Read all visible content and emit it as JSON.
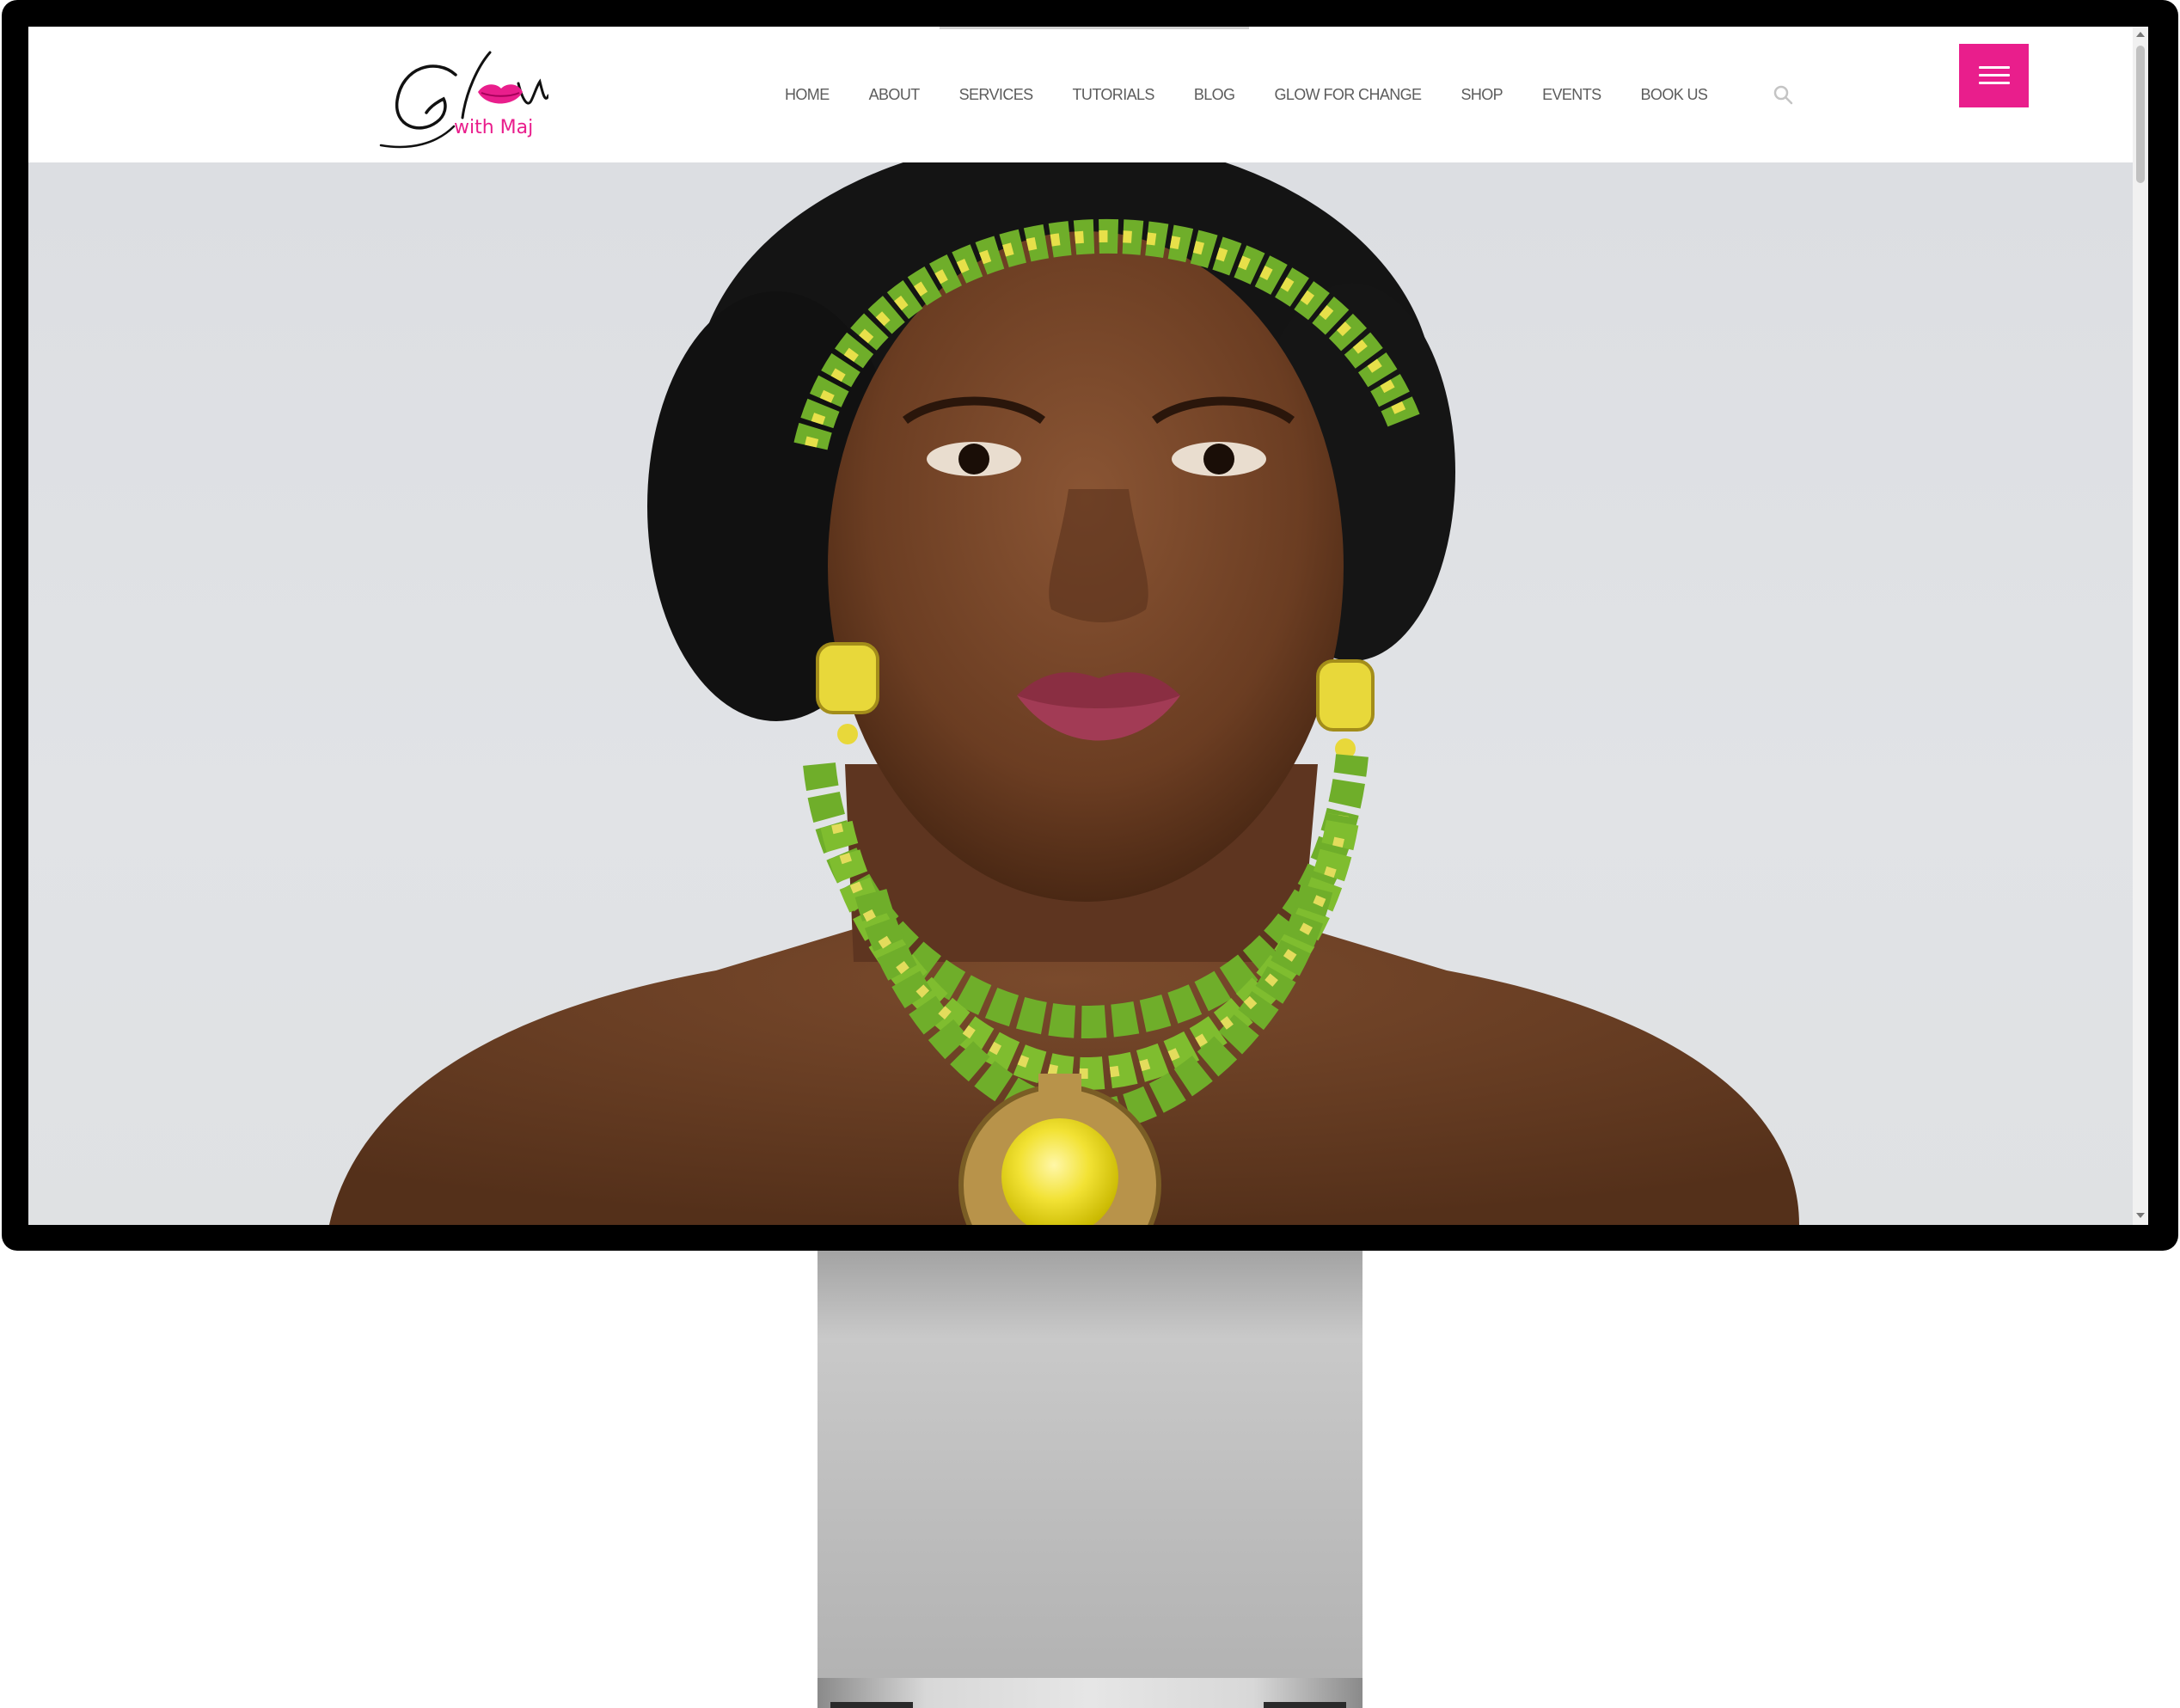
{
  "brand": {
    "logo_script": "Glow",
    "logo_sub": "with Maj",
    "accent_color": "#e91e8c"
  },
  "nav": {
    "items": [
      {
        "label": "HOME"
      },
      {
        "label": "ABOUT"
      },
      {
        "label": "SERVICES"
      },
      {
        "label": "TUTORIALS"
      },
      {
        "label": "BLOG"
      },
      {
        "label": "GLOW FOR CHANGE"
      },
      {
        "label": "SHOP"
      },
      {
        "label": "EVENTS"
      },
      {
        "label": "BOOK US"
      }
    ],
    "search_icon": "search-icon",
    "menu_icon": "hamburger-menu-icon"
  },
  "hero": {
    "image_description_icon": "portrait-photo",
    "background_color": "#dfe1e4"
  }
}
